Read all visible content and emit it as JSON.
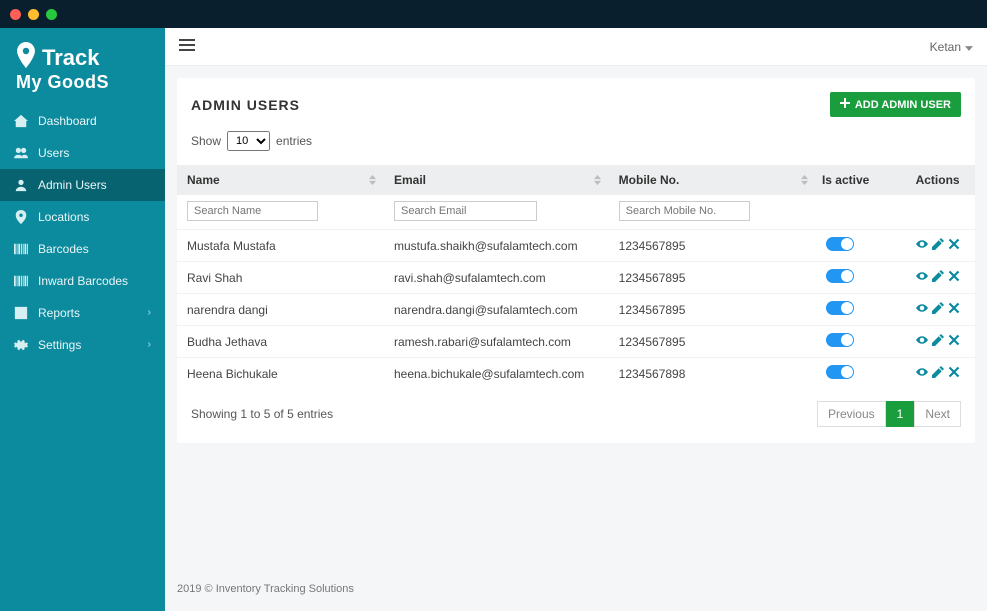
{
  "app": {
    "logo_line1": "Track",
    "logo_line2": "My GoodS"
  },
  "topbar": {
    "user_name": "Ketan"
  },
  "sidebar": {
    "items": [
      {
        "label": "Dashboard",
        "icon": "home-icon",
        "active": false
      },
      {
        "label": "Users",
        "icon": "users-icon",
        "active": false
      },
      {
        "label": "Admin Users",
        "icon": "person-icon",
        "active": true
      },
      {
        "label": "Locations",
        "icon": "pin-icon",
        "active": false
      },
      {
        "label": "Barcodes",
        "icon": "barcode-icon",
        "active": false
      },
      {
        "label": "Inward Barcodes",
        "icon": "barcode-icon",
        "active": false
      },
      {
        "label": "Reports",
        "icon": "report-icon",
        "active": false,
        "has_children": true
      },
      {
        "label": "Settings",
        "icon": "gear-icon",
        "active": false,
        "has_children": true
      }
    ]
  },
  "page": {
    "title": "ADMIN USERS",
    "add_button_label": "ADD ADMIN USER"
  },
  "table": {
    "show_label_pre": "Show",
    "show_label_post": "entries",
    "page_size": "10",
    "columns": {
      "name": "Name",
      "email": "Email",
      "mobile": "Mobile No.",
      "active": "Is active",
      "actions": "Actions"
    },
    "filters": {
      "name_placeholder": "Search Name",
      "email_placeholder": "Search Email",
      "mobile_placeholder": "Search Mobile No."
    },
    "rows": [
      {
        "name": "Mustafa Mustafa",
        "email": "mustufa.shaikh@sufalamtech.com",
        "mobile": "1234567895",
        "active": true
      },
      {
        "name": "Ravi Shah",
        "email": "ravi.shah@sufalamtech.com",
        "mobile": "1234567895",
        "active": true
      },
      {
        "name": "narendra dangi",
        "email": "narendra.dangi@sufalamtech.com",
        "mobile": "1234567895",
        "active": true
      },
      {
        "name": "Budha Jethava",
        "email": "ramesh.rabari@sufalamtech.com",
        "mobile": "1234567895",
        "active": true
      },
      {
        "name": "Heena Bichukale",
        "email": "heena.bichukale@sufalamtech.com",
        "mobile": "1234567898",
        "active": true
      }
    ],
    "info": "Showing 1 to 5 of 5 entries",
    "pager": {
      "prev": "Previous",
      "next": "Next",
      "current": "1"
    }
  },
  "footer": "2019 © Inventory Tracking Solutions"
}
